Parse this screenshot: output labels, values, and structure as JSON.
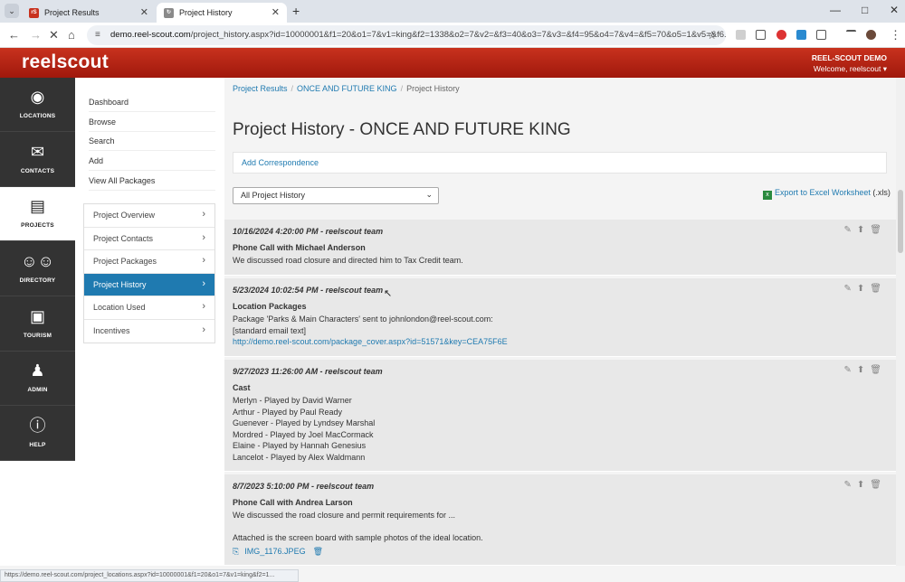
{
  "browser": {
    "tabs": [
      {
        "title": "Project Results",
        "favicon": "rs"
      },
      {
        "title": "Project History",
        "favicon": "history"
      }
    ],
    "url_host": "demo.reel-scout.com",
    "url_rest": "/project_history.aspx?id=10000001&f1=20&o1=7&v1=king&f2=1338&o2=7&v2=&f3=40&o3=7&v3=&f4=95&o4=7&v4=&f5=70&o5=1&v5=&f6...",
    "status_url": "https://demo.reel-scout.com/project_locations.aspx?id=10000001&f1=20&o1=7&v1=king&f2=1..."
  },
  "site": {
    "logo": "reelscout",
    "account": "REEL-SCOUT DEMO",
    "welcome": "Welcome, reelscout ▾"
  },
  "iconnav": [
    {
      "label": "LOCATIONS",
      "icon": "map-pin-icon"
    },
    {
      "label": "CONTACTS",
      "icon": "envelope-icon"
    },
    {
      "label": "PROJECTS",
      "icon": "archive-box-icon",
      "active": true
    },
    {
      "label": "DIRECTORY",
      "icon": "people-icon"
    },
    {
      "label": "TOURISM",
      "icon": "suitcase-icon"
    },
    {
      "label": "ADMIN",
      "icon": "spy-icon"
    },
    {
      "label": "HELP",
      "icon": "info-icon"
    }
  ],
  "submenu": {
    "top_links": [
      "Dashboard",
      "Browse",
      "Search",
      "Add",
      "View All Packages"
    ],
    "project_links": [
      "Project Overview",
      "Project Contacts",
      "Project Packages",
      "Project History",
      "Location Used",
      "Incentives"
    ],
    "active": "Project History"
  },
  "breadcrumb": [
    "Project Results",
    "ONCE AND FUTURE KING",
    "Project History"
  ],
  "page_title": "Project History - ONCE AND FUTURE KING",
  "add_correspondence": "Add Correspondence",
  "filter_selected": "All Project History",
  "export_label": "Export to Excel Worksheet",
  "export_ext": "(.xls)",
  "entries": [
    {
      "header": "10/16/2024 4:20:00 PM - reelscout team",
      "subject": "Phone Call with Michael Anderson",
      "lines": [
        "We discussed road closure and directed him to Tax Credit team."
      ]
    },
    {
      "header": "5/23/2024 10:02:54 PM - reelscout team",
      "subject": "Location Packages",
      "lines": [
        "Package 'Parks & Main Characters' sent to johnlondon@reel-scout.com:",
        "[standard email text]"
      ],
      "link": "http://demo.reel-scout.com/package_cover.aspx?id=51571&key=CEA75F6E"
    },
    {
      "header": "9/27/2023 11:26:00 AM - reelscout team",
      "subject": "Cast",
      "lines": [
        "Merlyn - Played by David Warner",
        "Arthur - Played by Paul Ready",
        "Guenever - Played by Lyndsey Marshal",
        "Mordred - Played by Joel MacCormack",
        "Elaine - Played by Hannah Genesius",
        "Lancelot - Played by Alex Waldmann"
      ]
    },
    {
      "header": "8/7/2023 5:10:00 PM - reelscout team",
      "subject": "Phone Call with Andrea Larson",
      "lines": [
        "We discussed the road closure and permit requirements for ...",
        "",
        "Attached is the screen board with sample photos of the ideal location."
      ],
      "attachment": "IMG_1176.JPEG"
    }
  ]
}
